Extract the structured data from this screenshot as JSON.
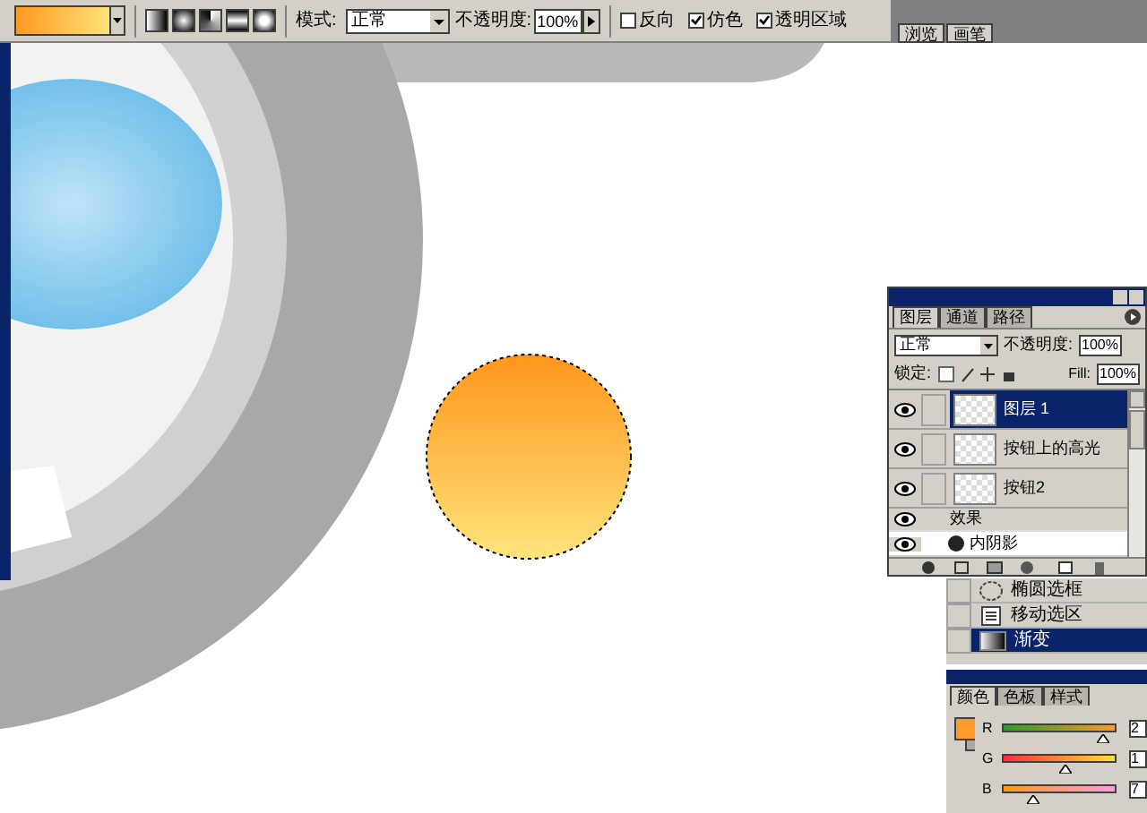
{
  "toolbar": {
    "mode_label": "模式:",
    "mode_value": "正常",
    "opacity_label": "不透明度:",
    "opacity_value": "100%",
    "options": [
      {
        "label": "反向",
        "checked": false
      },
      {
        "label": "仿色",
        "checked": true
      },
      {
        "label": "透明区域",
        "checked": true
      }
    ]
  },
  "palette_well_tabs": [
    {
      "label": "浏览"
    },
    {
      "label": "画笔"
    }
  ],
  "layers_panel": {
    "tabs": [
      {
        "label": "图层",
        "selected": true
      },
      {
        "label": "通道",
        "selected": false
      },
      {
        "label": "路径",
        "selected": false
      }
    ],
    "blend_mode": "正常",
    "opacity_label": "不透明度:",
    "opacity_value": "100%",
    "lock_label": "锁定:",
    "fill_label": "Fill:",
    "fill_value": "100%",
    "layers": [
      {
        "name": "图层 1",
        "selected": true,
        "visible": true
      },
      {
        "name": "按钮上的高光",
        "selected": false,
        "visible": true
      },
      {
        "name": "按钮2",
        "selected": false,
        "visible": true
      }
    ],
    "effects_label": "效果",
    "effects": [
      {
        "name": "内阴影"
      }
    ]
  },
  "history_panel": {
    "items": [
      {
        "name": "椭圆选框",
        "kind": "ellipse",
        "selected": false
      },
      {
        "name": "移动选区",
        "kind": "move",
        "selected": false
      },
      {
        "name": "渐变",
        "kind": "gradient",
        "selected": true
      }
    ]
  },
  "color_panel": {
    "tabs": [
      {
        "label": "颜色",
        "selected": true
      },
      {
        "label": "色板",
        "selected": false
      },
      {
        "label": "样式",
        "selected": false
      }
    ],
    "sliders": [
      {
        "label": "R",
        "level": 0.88,
        "value": "2"
      },
      {
        "label": "G",
        "level": 0.55,
        "value": "1"
      },
      {
        "label": "B",
        "level": 0.25,
        "value": "7"
      }
    ]
  }
}
